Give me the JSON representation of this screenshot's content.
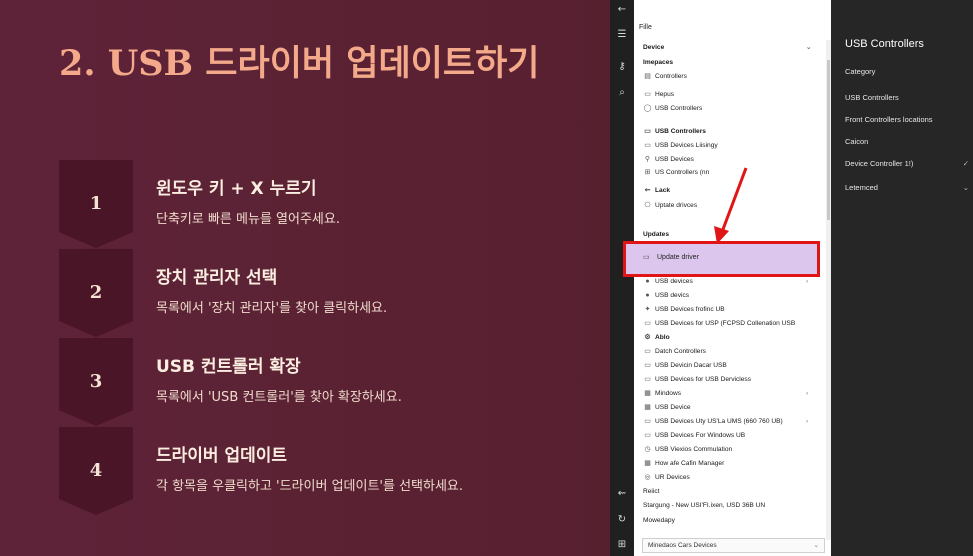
{
  "slide": {
    "title": "2. USB 드라이버 업데이트하기",
    "steps": [
      {
        "num": "1",
        "heading": "윈도우 키 + X 누르기",
        "desc": "단축키로 빠른 메뉴를 열어주세요."
      },
      {
        "num": "2",
        "heading": "장치 관리자 선택",
        "desc": "목록에서 '장치 관리자'를 찾아 클릭하세요."
      },
      {
        "num": "3",
        "heading": "USB 컨트롤러 확장",
        "desc": "목록에서 'USB 컨트롤러'를 찾아 확장하세요."
      },
      {
        "num": "4",
        "heading": "드라이버 업데이트",
        "desc": "각 항목을 우클릭하고 '드라이버 업데이트'를 선택하세요."
      }
    ]
  },
  "sidebar": {
    "icons": [
      "back-icon",
      "menu-icon",
      "key-icon",
      "search-icon",
      "accessibility-icon",
      "refresh-icon",
      "start-icon"
    ]
  },
  "settings": {
    "file_label": "Fille",
    "items": [
      {
        "label": "Device",
        "bold": true,
        "arrow": "⌄"
      },
      {
        "label": "Imepaces",
        "bold": true
      },
      {
        "label": "Controllers",
        "icon": "▤"
      },
      {
        "label": "Hepus",
        "icon": "▭"
      },
      {
        "label": "USB Controllers",
        "icon": "◯"
      },
      {
        "label": "USB Controllers",
        "icon": "▭",
        "bold": true
      },
      {
        "label": "USB Devices Liisingy",
        "icon": "▭"
      },
      {
        "label": "USB Devices",
        "icon": "⚲"
      },
      {
        "label": "US Controllers (nn",
        "icon": "⊞"
      },
      {
        "label": "Lack",
        "icon": "⇜",
        "bold": true
      },
      {
        "label": "Uptate drivces",
        "icon": "⎔"
      },
      {
        "label": "Updates",
        "bold": true
      },
      {
        "label": "USB devices",
        "icon": "●",
        "arrow": "›"
      },
      {
        "label": "USB devics",
        "icon": "●"
      },
      {
        "label": "USB Devices frofinc UB",
        "icon": "✦"
      },
      {
        "label": "USB Devices for USP (FCPSD Collenation USB",
        "icon": "▭"
      },
      {
        "label": "Ablo",
        "icon": "⚙",
        "bold": true
      },
      {
        "label": "Datch Controllers",
        "icon": "▭"
      },
      {
        "label": "USB Devicin Dacar USB",
        "icon": "▭"
      },
      {
        "label": "USB Devices for USB Dervicless",
        "icon": "▭"
      },
      {
        "label": "Mindows",
        "icon": "▦",
        "arrow": "›"
      },
      {
        "label": "USB Device",
        "icon": "▦"
      },
      {
        "label": "USB Devices Uty US'La UMS (660 760 UB)",
        "icon": "▭",
        "arrow": "›"
      },
      {
        "label": "USB Devices For Windows UB",
        "icon": "▭"
      },
      {
        "label": "USB Viexios Commulation",
        "icon": "◷"
      },
      {
        "label": "How afe Cafin Manager",
        "icon": "▦"
      },
      {
        "label": "UR Devices",
        "icon": "◎"
      },
      {
        "label": "Reiict",
        "bold": false
      },
      {
        "label": "Stargung - New USI'FI.ixen, USD 36B UN",
        "bold": false
      },
      {
        "label": "Mowedapy",
        "bold": false
      }
    ],
    "highlighted": "Update driver",
    "bottom_select": "Minedaos Cars Devices"
  },
  "right_panel": {
    "title": "USB Controllers",
    "items": [
      {
        "label": "Category"
      },
      {
        "label": "USB Controllers"
      },
      {
        "label": "Front Controllers locations"
      },
      {
        "label": "Caicon"
      },
      {
        "label": "Device Controller 1!)",
        "chevron": "✓"
      },
      {
        "label": "Letemced",
        "chevron": "⌄"
      }
    ]
  },
  "window_controls": {
    "minimize": "—",
    "maximize": "☐",
    "close": "✕"
  },
  "colors": {
    "highlight_border": "#e01515",
    "highlight_fill": "#dcc6ee",
    "title": "#f3a98a",
    "slide_bg": "#5f2339"
  }
}
